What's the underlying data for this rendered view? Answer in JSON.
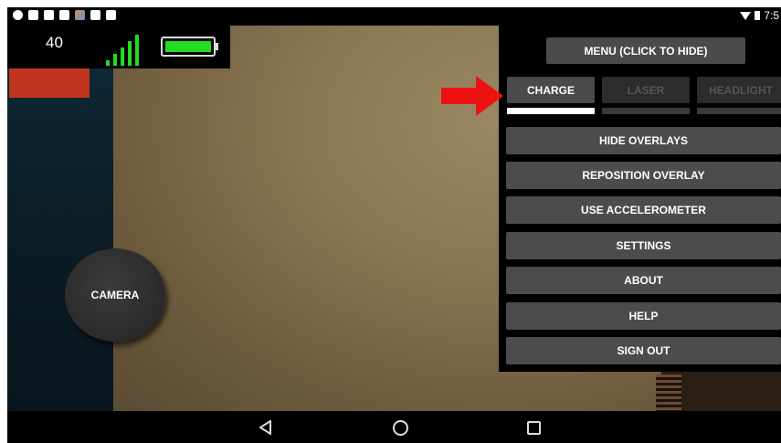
{
  "status_bar": {
    "left_icons": [
      "notification-icon",
      "image-icon",
      "sd-card-icon",
      "image-icon",
      "photo-icon",
      "briefcase-icon",
      "briefcase-icon"
    ],
    "time": "7:5"
  },
  "hud": {
    "count": "40",
    "signal_bars": 5,
    "battery_level": 1.0,
    "accent_color": "#22dd22"
  },
  "camera_button": {
    "label": "CAMERA"
  },
  "menu": {
    "toggle_label": "MENU (CLICK TO HIDE)",
    "tabs": [
      {
        "label": "CHARGE",
        "active": true
      },
      {
        "label": "LASER",
        "active": false
      },
      {
        "label": "HEADLIGHT",
        "active": false
      }
    ],
    "items": [
      {
        "label": "HIDE OVERLAYS"
      },
      {
        "label": "REPOSITION OVERLAY"
      },
      {
        "label": "USE ACCELEROMETER"
      },
      {
        "label": "SETTINGS"
      },
      {
        "label": "ABOUT"
      },
      {
        "label": "HELP"
      },
      {
        "label": "SIGN OUT"
      }
    ]
  },
  "annotation": {
    "arrow_color": "#ee1111"
  },
  "nav_bar": {
    "icons": [
      "back-icon",
      "home-icon",
      "recent-apps-icon"
    ]
  }
}
